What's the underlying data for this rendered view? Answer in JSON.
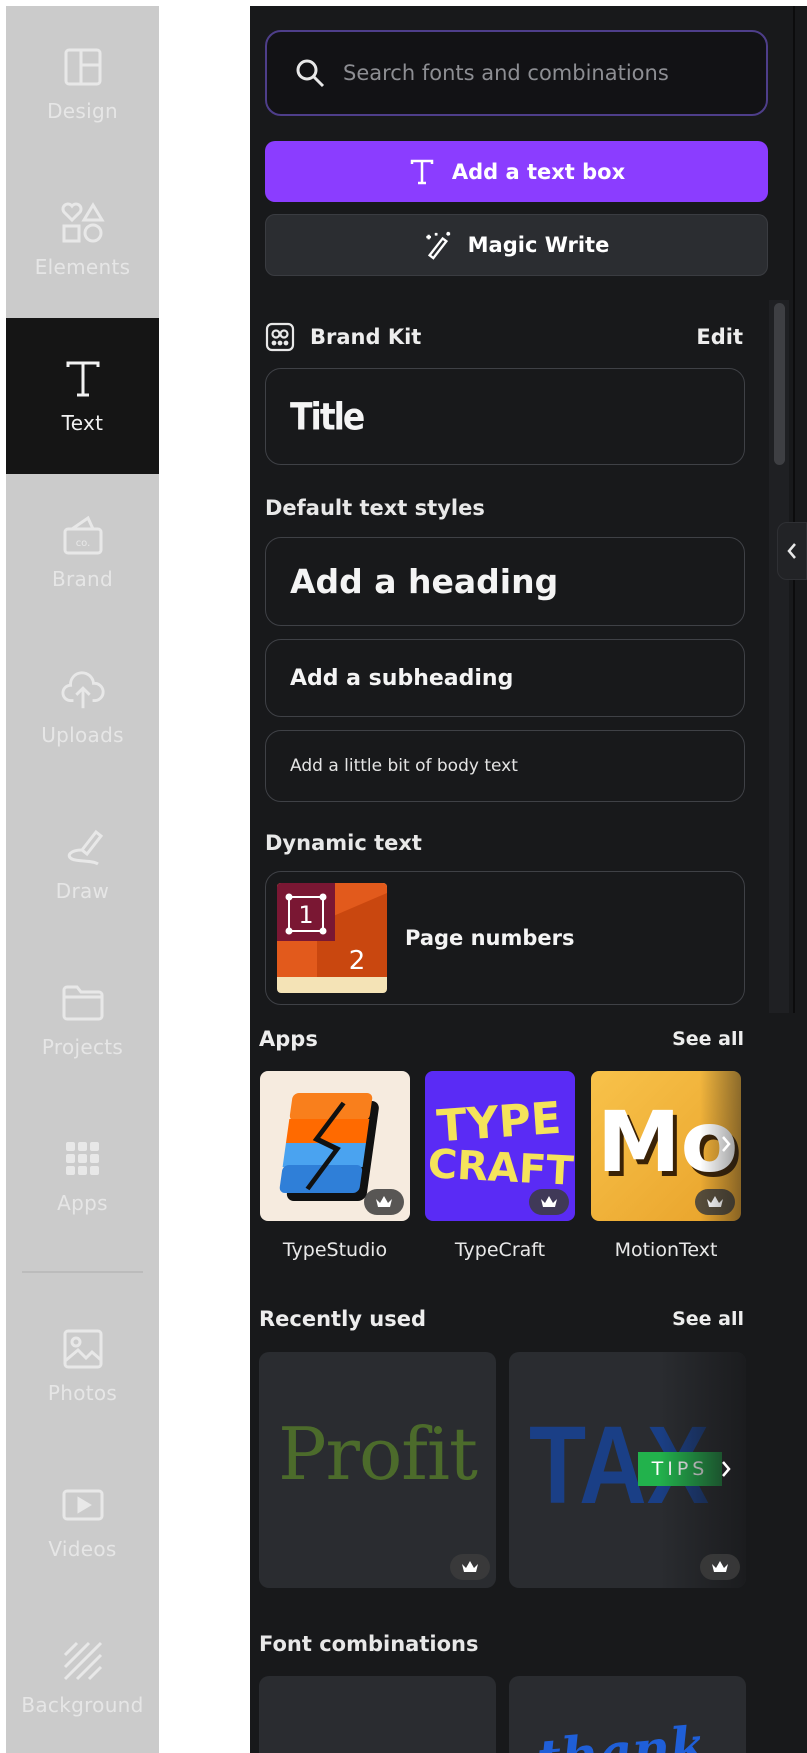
{
  "rail": {
    "items": [
      {
        "label": "Design",
        "icon": "layout-icon"
      },
      {
        "label": "Elements",
        "icon": "shapes-icon"
      },
      {
        "label": "Text",
        "icon": "text-t-icon",
        "active": true
      },
      {
        "label": "Brand",
        "icon": "brand-icon"
      },
      {
        "label": "Uploads",
        "icon": "cloud-upload-icon"
      },
      {
        "label": "Draw",
        "icon": "draw-icon"
      },
      {
        "label": "Projects",
        "icon": "folder-icon"
      },
      {
        "label": "Apps",
        "icon": "grid-icon"
      },
      {
        "label": "Photos",
        "icon": "photo-icon"
      },
      {
        "label": "Videos",
        "icon": "video-icon"
      },
      {
        "label": "Background",
        "icon": "hatch-icon"
      }
    ]
  },
  "panel": {
    "search_placeholder": "Search fonts and combinations",
    "add_text_box": "Add a text box",
    "magic_write": "Magic Write",
    "brand_kit": {
      "label": "Brand Kit",
      "edit": "Edit",
      "title_style": "Title"
    },
    "default_styles": {
      "label": "Default text styles",
      "heading": "Add a heading",
      "subheading": "Add a subheading",
      "body": "Add a little bit of body text"
    },
    "dynamic_text": {
      "label": "Dynamic text",
      "page_numbers": "Page numbers",
      "thumb_num_1": "1",
      "thumb_num_2": "2"
    },
    "apps": {
      "label": "Apps",
      "see_all": "See all",
      "items": [
        {
          "name": "TypeStudio"
        },
        {
          "name": "TypeCraft",
          "art_line1": "TYPE",
          "art_line2": "CRAFT"
        },
        {
          "name": "MotionText",
          "art": "Mo"
        }
      ]
    },
    "recently_used": {
      "label": "Recently used",
      "see_all": "See all",
      "items": [
        {
          "text": "Profit"
        },
        {
          "text": "TAX",
          "badge": "TIPS"
        }
      ]
    },
    "font_combinations": {
      "label": "Font combinations",
      "items": [
        {
          "text": ""
        },
        {
          "text": "thank"
        }
      ]
    }
  },
  "colors": {
    "accent": "#8b3dff",
    "panel_bg": "#18191b",
    "rail_bg": "#cbcbcb"
  }
}
